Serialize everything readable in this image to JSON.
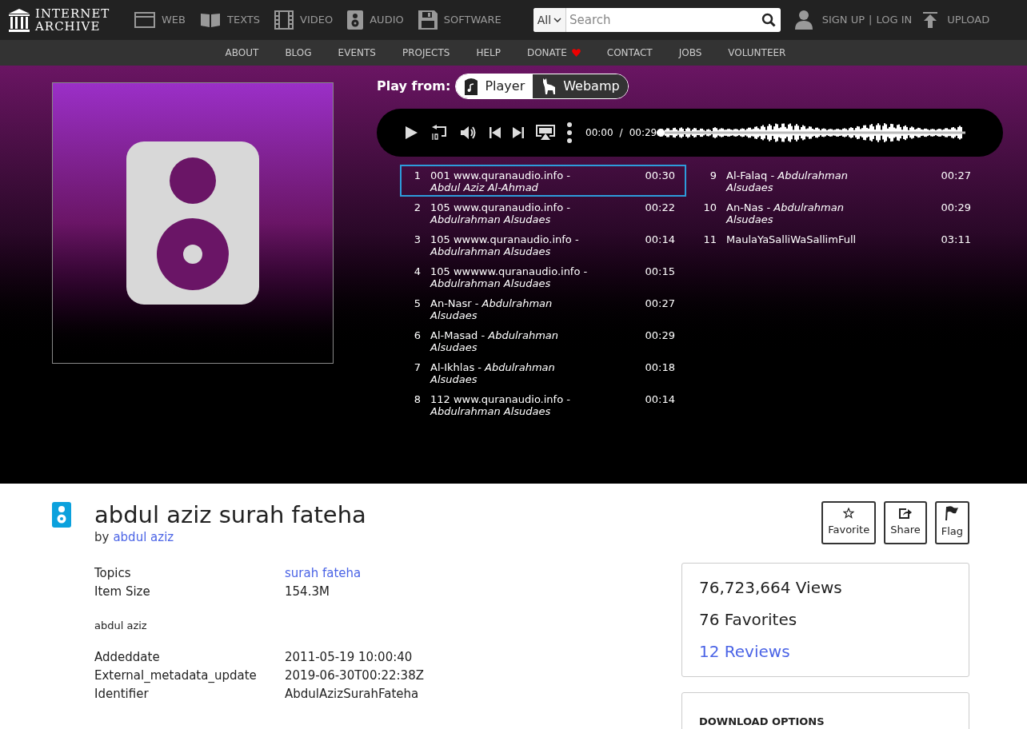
{
  "logo": {
    "line1": "INTERNET",
    "line2": "ARCHIVE"
  },
  "media_nav": [
    {
      "kind": "web",
      "label": "WEB"
    },
    {
      "kind": "texts",
      "label": "TEXTS"
    },
    {
      "kind": "video",
      "label": "VIDEO"
    },
    {
      "kind": "audio",
      "label": "AUDIO"
    },
    {
      "kind": "software",
      "label": "SOFTWARE"
    }
  ],
  "search": {
    "scope": "All",
    "placeholder": "Search"
  },
  "account": {
    "signup": "SIGN UP",
    "separator": "|",
    "login": "LOG IN",
    "upload": "UPLOAD"
  },
  "sub_nav": [
    {
      "label": "ABOUT",
      "heart": false
    },
    {
      "label": "BLOG",
      "heart": false
    },
    {
      "label": "EVENTS",
      "heart": false
    },
    {
      "label": "PROJECTS",
      "heart": false
    },
    {
      "label": "HELP",
      "heart": false
    },
    {
      "label": "DONATE",
      "heart": true
    },
    {
      "label": "CONTACT",
      "heart": false
    },
    {
      "label": "JOBS",
      "heart": false
    },
    {
      "label": "VOLUNTEER",
      "heart": false
    }
  ],
  "play_from": {
    "label": "Play from:",
    "options": [
      {
        "kind": "player",
        "label": "Player",
        "selected": true
      },
      {
        "kind": "webamp",
        "label": "Webamp",
        "selected": false
      }
    ]
  },
  "player": {
    "current": "00:00",
    "separator": "/",
    "duration": "00:29"
  },
  "playlist": {
    "columns": [
      [
        {
          "number": "1",
          "title": "001 www.quranaudio.info - *Abdul Aziz Al-Ahmad*",
          "duration": "00:30",
          "selected": true
        },
        {
          "number": "2",
          "title": "105 www.quranaudio.info - *Abdulrahman Alsudaes*",
          "duration": "00:22",
          "selected": false
        },
        {
          "number": "3",
          "title": "105 wwww.quranaudio.info - *Abdulrahman Alsudaes*",
          "duration": "00:14",
          "selected": false
        },
        {
          "number": "4",
          "title": "105 wwwww.quranaudio.info - *Abdulrahman Alsudaes*",
          "duration": "00:15",
          "selected": false
        },
        {
          "number": "5",
          "title": "An-Nasr - *Abdulrahman Alsudaes*",
          "duration": "00:27",
          "selected": false
        },
        {
          "number": "6",
          "title": "Al-Masad - *Abdulrahman Alsudaes*",
          "duration": "00:29",
          "selected": false
        },
        {
          "number": "7",
          "title": "Al-Ikhlas - *Abdulrahman Alsudaes*",
          "duration": "00:18",
          "selected": false
        },
        {
          "number": "8",
          "title": "112 www.quranaudio.info - *Abdulrahman Alsudaes*",
          "duration": "00:14",
          "selected": false
        }
      ],
      [
        {
          "number": "9",
          "title": "Al-Falaq - *Abdulrahman Alsudaes*",
          "duration": "00:27",
          "selected": false
        },
        {
          "number": "10",
          "title": "An-Nas - *Abdulrahman Alsudaes*",
          "duration": "00:29",
          "selected": false
        },
        {
          "number": "11",
          "title": "MaulaYaSalliWaSallimFull",
          "duration": "03:11",
          "selected": false
        }
      ]
    ]
  },
  "item": {
    "title": "abdul aziz surah fateha",
    "by": "by",
    "creator": "abdul aziz"
  },
  "actions": [
    {
      "kind": "favorite",
      "label": "Favorite"
    },
    {
      "kind": "share",
      "label": "Share"
    },
    {
      "kind": "flag",
      "label": "Flag"
    }
  ],
  "metadata": [
    {
      "key": "Topics",
      "value": "surah fateha",
      "link": true
    },
    {
      "key": "Item Size",
      "value": "154.3M",
      "link": false
    }
  ],
  "description": "abdul aziz",
  "metadata_extra": [
    {
      "key": "Addeddate",
      "value": "2011-05-19 10:00:40"
    },
    {
      "key": "External_metadata_update",
      "value": "2019-06-30T00:22:38Z"
    },
    {
      "key": "Identifier",
      "value": "AbdulAzizSurahFateha"
    }
  ],
  "stats": [
    {
      "text": "76,723,664 Views",
      "link": false
    },
    {
      "text": "76 Favorites",
      "link": false
    },
    {
      "text": "12 Reviews",
      "link": true
    }
  ],
  "download": {
    "title": "DOWNLOAD OPTIONS"
  }
}
